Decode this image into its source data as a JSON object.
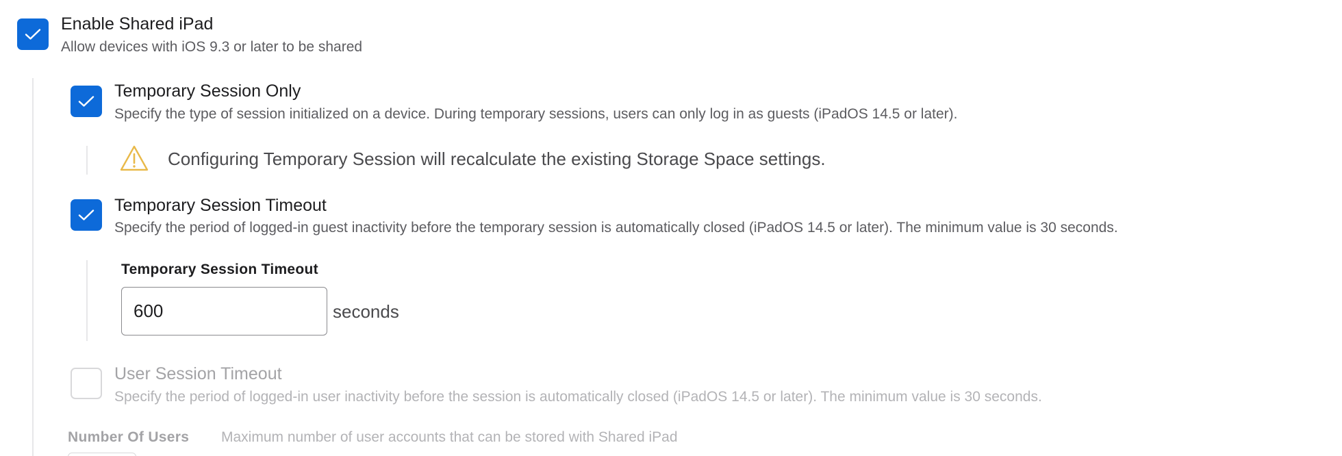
{
  "shared_ipad": {
    "enable": {
      "title": "Enable Shared iPad",
      "description": "Allow devices with iOS 9.3 or later to be shared",
      "checked": true
    },
    "temporary_session_only": {
      "title": "Temporary Session Only",
      "description": "Specify the type of session initialized on a device. During temporary sessions, users can only log in as guests (iPadOS 14.5 or later).",
      "checked": true,
      "warning": "Configuring Temporary Session will recalculate the existing Storage Space settings."
    },
    "temporary_session_timeout": {
      "title": "Temporary Session Timeout",
      "description": "Specify the period of logged-in guest inactivity before the temporary session is automatically closed (iPadOS 14.5 or later). The minimum value is 30 seconds.",
      "checked": true,
      "field_label": "Temporary Session Timeout",
      "value": "600",
      "unit": "seconds"
    },
    "user_session_timeout": {
      "title": "User Session Timeout",
      "description": "Specify the period of logged-in user inactivity before the session is automatically closed (iPadOS 14.5 or later). The minimum value is 30 seconds.",
      "checked": false,
      "disabled": true
    },
    "number_of_users": {
      "label": "Number Of Users",
      "description": "Maximum number of user accounts that can be stored with Shared iPad"
    }
  },
  "icons": {
    "checkmark": "checkmark-icon",
    "warning": "warning-triangle-icon"
  },
  "colors": {
    "accent": "#0d6ad9",
    "warning": "#e9b949",
    "disabled_text": "#a3a3a6"
  }
}
